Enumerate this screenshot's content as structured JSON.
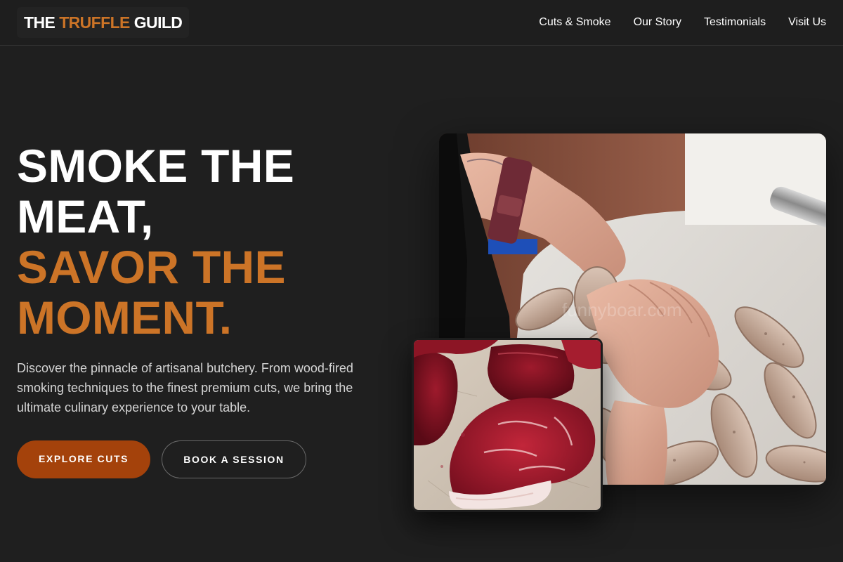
{
  "header": {
    "brand": {
      "word_a": "THE",
      "word_b": "TRUFFLE",
      "word_c": "GUILD"
    },
    "nav": [
      {
        "label": "Cuts & Smoke"
      },
      {
        "label": "Our Story"
      },
      {
        "label": "Testimonials"
      },
      {
        "label": "Visit Us"
      }
    ]
  },
  "hero": {
    "title_lines": [
      "SMOKE THE",
      "MEAT,"
    ],
    "accent_lines": [
      "SAVOR THE",
      "MOMENT."
    ],
    "description": "Discover the pinnacle of artisanal butchery. From wood-fired smoking techniques to the finest premium cuts, we bring the ultimate culinary experience to your table.",
    "primary_cta": "EXPLORE CUTS",
    "secondary_cta": "BOOK A SESSION"
  },
  "images": {
    "main": {
      "subject": "hands-tying-sausage-links-photo",
      "watermark": "funnyboar.com"
    },
    "inset": {
      "subject": "raw-beef-cuts-on-board-photo"
    }
  },
  "colors": {
    "background": "#1f1f1f",
    "accent": "#cc7427",
    "primary_button": "#a4420b"
  }
}
